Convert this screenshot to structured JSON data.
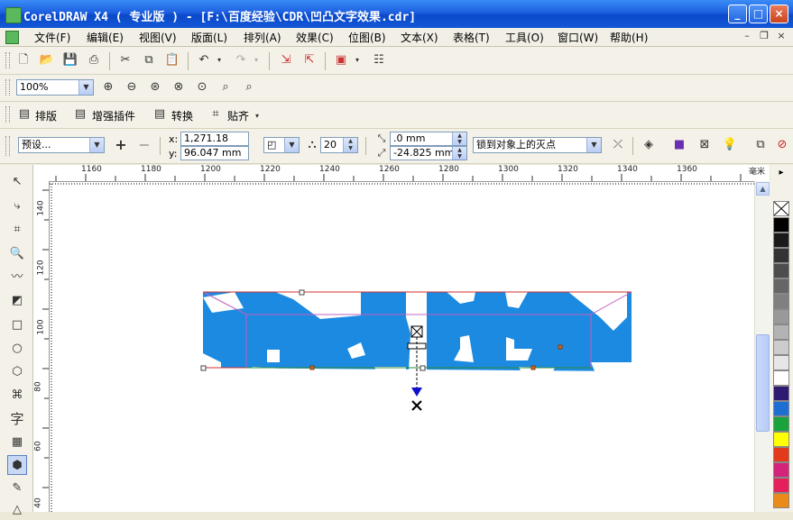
{
  "window": {
    "title": "CorelDRAW X4 ( 专业版 ) - [F:\\百度经验\\CDR\\凹凸文字效果.cdr]"
  },
  "menu": [
    "文件(F)",
    "编辑(E)",
    "视图(V)",
    "版面(L)",
    "排列(A)",
    "效果(C)",
    "位图(B)",
    "文本(X)",
    "表格(T)",
    "工具(O)",
    "窗口(W)",
    "帮助(H)"
  ],
  "zoom": {
    "value": "100%"
  },
  "plugin_toolbar": [
    "排版",
    "增强插件",
    "转换",
    "贴齐"
  ],
  "property_bar": {
    "preset": "预设...",
    "x_label": "x:",
    "x_value": "1,271.18 mm",
    "y_label": "y:",
    "y_value": "96.047 mm",
    "depth": "20",
    "vp_x": ".0 mm",
    "vp_y": "-24.825 mm",
    "vp_lock": "锁到对象上的灭点"
  },
  "ruler": {
    "h_ticks": [
      "1160",
      "1180",
      "1200",
      "1220",
      "1240",
      "1260",
      "1280",
      "1300",
      "1320",
      "1340",
      "1360"
    ],
    "unit": "毫米",
    "v_ticks": [
      "140",
      "120",
      "100",
      "80",
      "60",
      "40"
    ]
  },
  "palette": {
    "colors": [
      "#000000",
      "#1a1a1a",
      "#333333",
      "#4d4d4d",
      "#666666",
      "#808080",
      "#999999",
      "#b3b3b3",
      "#cccccc",
      "#e6e6e6",
      "#ffffff",
      "#2e1a73",
      "#1e6fd4",
      "#1aa33c",
      "#ffff00",
      "#e23a1a",
      "#d4237a",
      "#e61e5a",
      "#e98a1a"
    ]
  },
  "canvas": {
    "fill_color": "#1b8ae0"
  }
}
